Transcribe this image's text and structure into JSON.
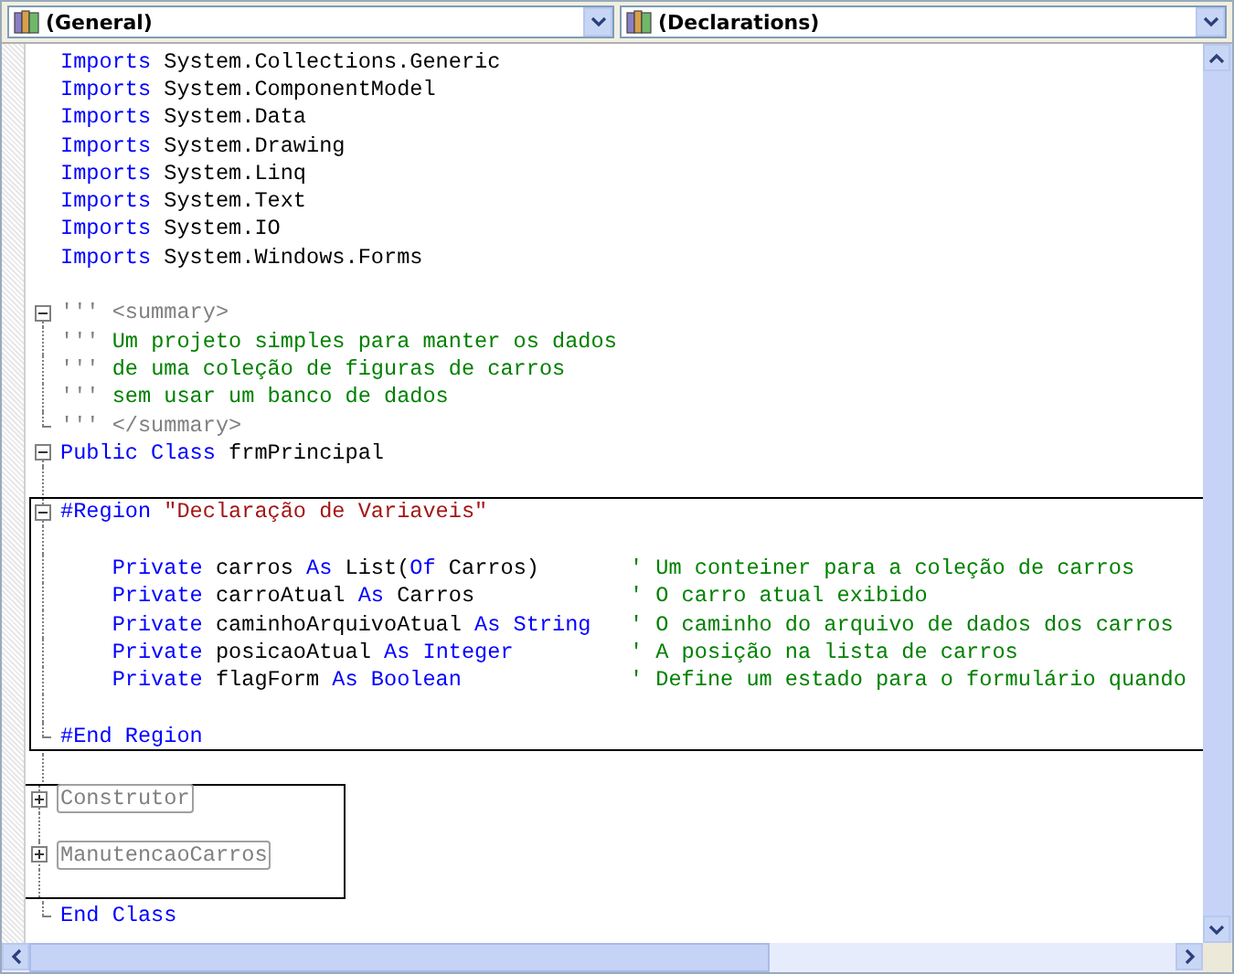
{
  "combos": [
    {
      "label": "(General)"
    },
    {
      "label": "(Declarations)"
    }
  ],
  "blocks": [
    {
      "boxed": false,
      "lines": [
        {
          "kind": "statement",
          "tokens": [
            {
              "kind": "keyword",
              "text": "Imports"
            },
            {
              "kind": "plain",
              "text": " System.Collections.Generic"
            }
          ]
        },
        {
          "kind": "statement",
          "tokens": [
            {
              "kind": "keyword",
              "text": "Imports"
            },
            {
              "kind": "plain",
              "text": " System.ComponentModel"
            }
          ]
        },
        {
          "kind": "statement",
          "tokens": [
            {
              "kind": "keyword",
              "text": "Imports"
            },
            {
              "kind": "plain",
              "text": " System.Data"
            }
          ]
        },
        {
          "kind": "statement",
          "tokens": [
            {
              "kind": "keyword",
              "text": "Imports"
            },
            {
              "kind": "plain",
              "text": " System.Drawing"
            }
          ]
        },
        {
          "kind": "statement",
          "tokens": [
            {
              "kind": "keyword",
              "text": "Imports"
            },
            {
              "kind": "plain",
              "text": " System.Linq"
            }
          ]
        },
        {
          "kind": "statement",
          "tokens": [
            {
              "kind": "keyword",
              "text": "Imports"
            },
            {
              "kind": "plain",
              "text": " System.Text"
            }
          ]
        },
        {
          "kind": "statement",
          "tokens": [
            {
              "kind": "keyword",
              "text": "Imports"
            },
            {
              "kind": "plain",
              "text": " System.IO"
            }
          ]
        },
        {
          "kind": "statement",
          "tokens": [
            {
              "kind": "keyword",
              "text": "Imports"
            },
            {
              "kind": "plain",
              "text": " System.Windows.Forms"
            }
          ]
        },
        {
          "kind": "blank"
        },
        {
          "kind": "statement",
          "expanded": true,
          "tokens": [
            {
              "kind": "doc",
              "text": "''' <summary>"
            }
          ]
        },
        {
          "kind": "statement",
          "tokens": [
            {
              "kind": "doc",
              "text": "'''"
            },
            {
              "kind": "comment",
              "text": " Um projeto simples para manter os dados"
            }
          ]
        },
        {
          "kind": "statement",
          "tokens": [
            {
              "kind": "doc",
              "text": "'''"
            },
            {
              "kind": "comment",
              "text": " de uma coleção de figuras de carros"
            }
          ]
        },
        {
          "kind": "statement",
          "tokens": [
            {
              "kind": "doc",
              "text": "'''"
            },
            {
              "kind": "comment",
              "text": " sem usar um banco de dados"
            }
          ]
        },
        {
          "kind": "statement",
          "fold_end": true,
          "tokens": [
            {
              "kind": "doc",
              "text": "''' </summary>"
            }
          ]
        },
        {
          "kind": "statement",
          "expanded": true,
          "tokens": [
            {
              "kind": "keyword",
              "text": "Public Class"
            },
            {
              "kind": "plain",
              "text": " frmPrincipal"
            }
          ]
        },
        {
          "kind": "blank"
        }
      ]
    },
    {
      "boxed": true,
      "lines": [
        {
          "kind": "statement",
          "expanded": true,
          "tokens": [
            {
              "kind": "keyword",
              "text": "#Region"
            },
            {
              "kind": "string",
              "text": " \"Declaração de Variaveis\""
            }
          ]
        },
        {
          "kind": "blank"
        },
        {
          "kind": "member",
          "tokens": [
            {
              "kind": "keyword",
              "text": "Private"
            },
            {
              "kind": "plain",
              "text": " carros "
            },
            {
              "kind": "keyword",
              "text": "As"
            },
            {
              "kind": "plain",
              "text": " List("
            },
            {
              "kind": "keyword",
              "text": "Of"
            },
            {
              "kind": "plain",
              "text": " Carros)"
            }
          ],
          "comment": "' Um conteiner para a coleção de carros"
        },
        {
          "kind": "member",
          "tokens": [
            {
              "kind": "keyword",
              "text": "Private"
            },
            {
              "kind": "plain",
              "text": " carroAtual "
            },
            {
              "kind": "keyword",
              "text": "As"
            },
            {
              "kind": "plain",
              "text": " Carros"
            }
          ],
          "comment": "' O carro atual exibido"
        },
        {
          "kind": "member",
          "tokens": [
            {
              "kind": "keyword",
              "text": "Private"
            },
            {
              "kind": "plain",
              "text": " caminhoArquivoAtual "
            },
            {
              "kind": "keyword",
              "text": "As String"
            }
          ],
          "comment": "' O caminho do arquivo de dados dos carros"
        },
        {
          "kind": "member",
          "tokens": [
            {
              "kind": "keyword",
              "text": "Private"
            },
            {
              "kind": "plain",
              "text": " posicaoAtual "
            },
            {
              "kind": "keyword",
              "text": "As Integer"
            }
          ],
          "comment": "' A posição na lista de carros"
        },
        {
          "kind": "member",
          "tokens": [
            {
              "kind": "keyword",
              "text": "Private"
            },
            {
              "kind": "plain",
              "text": " flagForm "
            },
            {
              "kind": "keyword",
              "text": "As Boolean"
            }
          ],
          "comment": "' Define um estado para o formulário quando"
        },
        {
          "kind": "blank"
        },
        {
          "kind": "statement",
          "fold_end": true,
          "tokens": [
            {
              "kind": "keyword",
              "text": "#End Region"
            }
          ]
        }
      ]
    },
    {
      "boxed": false,
      "lines": [
        {
          "kind": "blank"
        }
      ]
    },
    {
      "boxed": true,
      "lines": [
        {
          "kind": "statement",
          "expanded": false,
          "tokens": [
            {
              "kind": "collapsed",
              "text": "Construtor"
            }
          ]
        },
        {
          "kind": "blank"
        },
        {
          "kind": "statement",
          "expanded": false,
          "tokens": [
            {
              "kind": "collapsed",
              "text": "ManutencaoCarros"
            }
          ]
        },
        {
          "kind": "blank"
        }
      ]
    },
    {
      "boxed": false,
      "lines": [
        {
          "kind": "statement",
          "fold_end": true,
          "tokens": [
            {
              "kind": "keyword",
              "text": "End Class"
            }
          ]
        }
      ]
    }
  ]
}
